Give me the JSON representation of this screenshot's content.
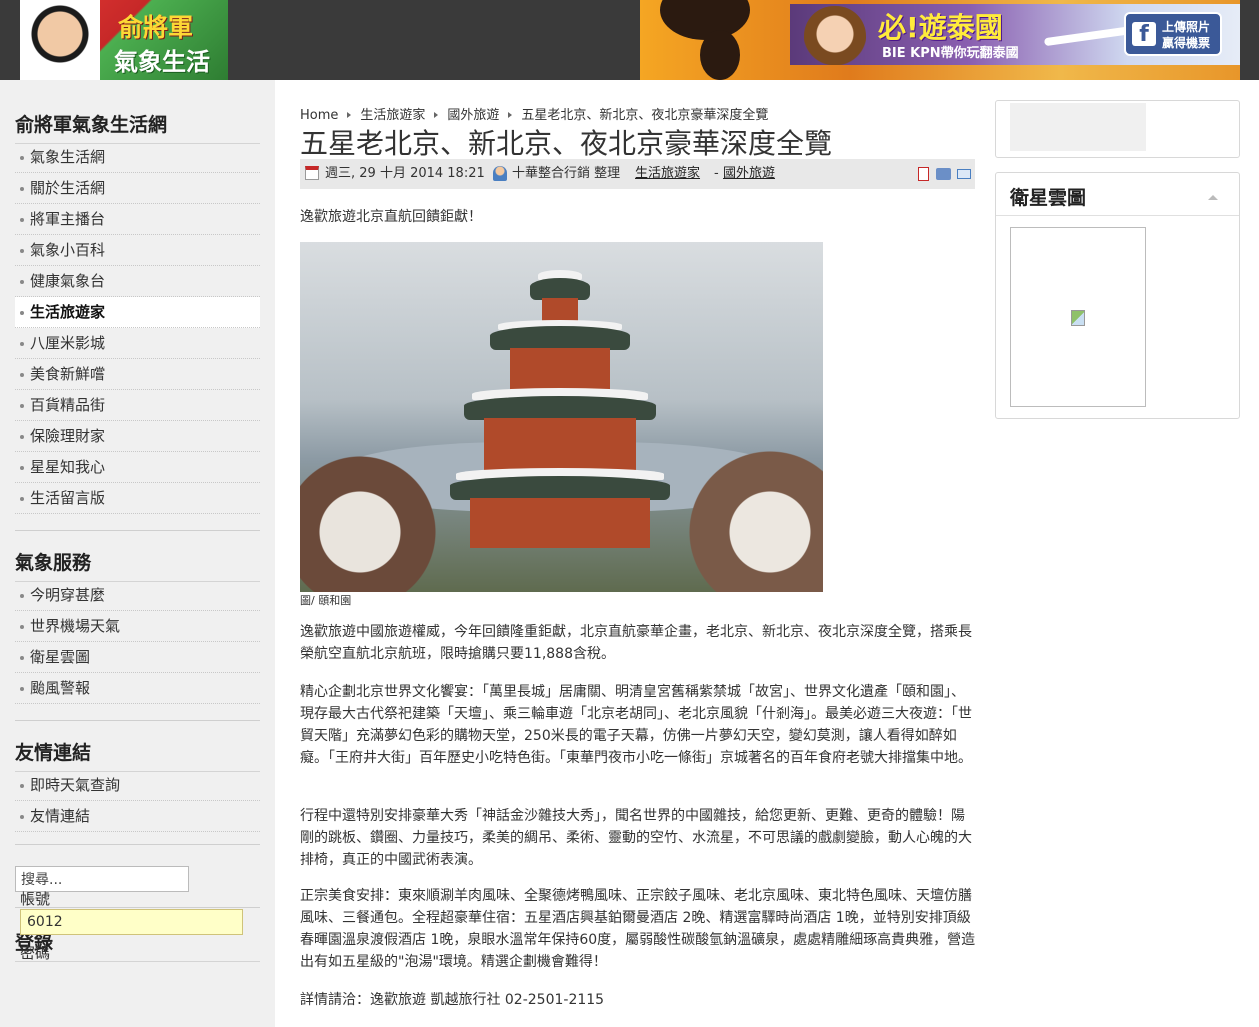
{
  "header": {
    "logo_line1": "俞將軍",
    "logo_line2": "氣象生活網",
    "ad_title": "必!遊泰國",
    "ad_subtitle": "BIE KPN帶你玩翻泰國",
    "ad_fb_text": "上傳照片 贏得機票"
  },
  "sidebar": {
    "section1_title": "俞將軍氣象生活網",
    "section1_items": [
      {
        "label": "氣象生活網",
        "active": false
      },
      {
        "label": "關於生活網",
        "active": false
      },
      {
        "label": "將軍主播台",
        "active": false
      },
      {
        "label": "氣象小百科",
        "active": false
      },
      {
        "label": "健康氣象台",
        "active": false
      },
      {
        "label": "生活旅遊家",
        "active": true
      },
      {
        "label": "八厘米影城",
        "active": false
      },
      {
        "label": "美食新鮮嚐",
        "active": false
      },
      {
        "label": "百貨精品街",
        "active": false
      },
      {
        "label": "保險理財家",
        "active": false
      },
      {
        "label": "星星知我心",
        "active": false
      },
      {
        "label": "生活留言版",
        "active": false
      }
    ],
    "section2_title": "氣象服務",
    "section2_items": [
      {
        "label": "今明穿甚麼"
      },
      {
        "label": "世界機場天氣"
      },
      {
        "label": "衛星雲圖"
      },
      {
        "label": "颱風警報"
      }
    ],
    "section3_title": "友情連結",
    "section3_items": [
      {
        "label": "即時天氣查詢"
      },
      {
        "label": "友情連結"
      }
    ],
    "search_value": "搜尋...",
    "login_title": "登錄",
    "login_username_label": "帳號",
    "login_username_value": "6012",
    "login_password_label": "密碼"
  },
  "article": {
    "breadcrumb": [
      "Home",
      "生活旅遊家",
      "國外旅遊",
      "五星老北京、新北京、夜北京豪華深度全覽"
    ],
    "title": "五星老北京、新北京、夜北京豪華深度全覽",
    "date": "週三, 29 十月 2014 18:21",
    "author": "十華整合行銷 整理",
    "category1": "生活旅遊家",
    "category_sep": "-",
    "category2": "國外旅遊",
    "intro": "逸歡旅遊北京直航回饋鉅獻！",
    "photo_caption": "圖/ 頤和園",
    "p1": "逸歡旅遊中國旅遊權威，今年回饋隆重鉅獻，北京直航豪華企畫，老北京、新北京、夜北京深度全覽，搭乘長榮航空直航北京航班，限時搶購只要11,888含稅。",
    "p2": "精心企劃北京世界文化饗宴：「萬里長城」居庸關、明清皇宮舊稱紫禁城「故宮」、世界文化遺產「頤和園」、現存最大古代祭祀建築「天壇」、乘三輪車遊「北京老胡同」、老北京風貌「什剎海」。最美必遊三大夜遊：「世貿天階」充滿夢幻色彩的購物天堂，250米長的電子天幕，仿佛一片夢幻天空，變幻莫測，讓人看得如醉如癡。「王府井大街」百年歷史小吃特色街。「東華門夜市小吃一條街」京城著名的百年食府老號大排擋集中地。",
    "p3": "行程中還特別安排豪華大秀「神話金沙雜技大秀」，聞名世界的中國雜技，給您更新、更難、更奇的體驗！陽剛的跳板、鑽圈、力量技巧，柔美的綢吊、柔術、靈動的空竹、水流星，不可思議的戲劇變臉，動人心魄的大排椅，真正的中國武術表演。",
    "p4": "正宗美食安排：東來順涮羊肉風味、全聚德烤鴨風味、正宗餃子風味、老北京風味、東北特色風味、天壇仿膳風味、三餐通包。全程超豪華住宿：五星酒店興基鉑爾曼酒店 2晚、精選富驛時尚酒店 1晚，並特別安排頂級春暉園溫泉渡假酒店 1晚，泉眼水溫常年保持60度，屬弱酸性碳酸氫鈉溫礦泉，處處精雕細琢高貴典雅，營造出有如五星級的\"泡湯\"環境。精選企劃機會難得！",
    "p5": "詳情請洽：逸歡旅遊 凱越旅行社 02-2501-2115"
  },
  "right": {
    "satellite_title": "衛星雲圖"
  },
  "icons": {
    "calendar": "calendar-icon",
    "user": "user-icon",
    "pdf": "pdf-icon",
    "print": "print-icon",
    "email": "email-icon"
  }
}
